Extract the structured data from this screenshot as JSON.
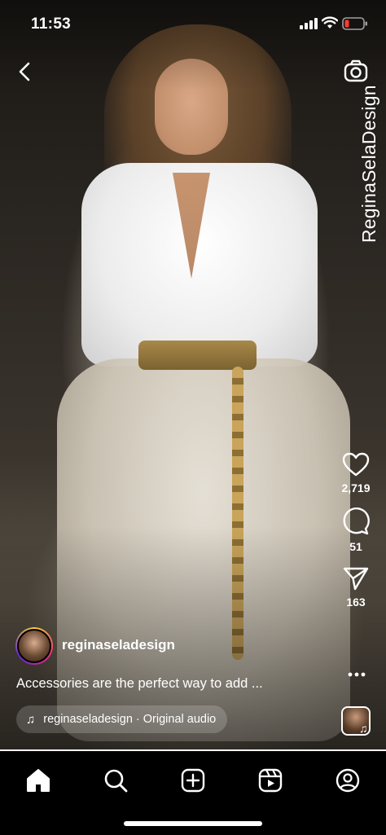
{
  "status_bar": {
    "time": "11:53"
  },
  "watermark": {
    "text": "ReginaSelaDesign"
  },
  "post": {
    "username": "reginaseladesign",
    "caption": "Accessories are the perfect way to add ...",
    "audio_label": "reginaseladesign · Original audio"
  },
  "actions": {
    "likes": "2,719",
    "comments": "51",
    "shares": "163"
  },
  "playback": {
    "progress": 1.0
  },
  "icons": {
    "back": "chevron-left-icon",
    "camera": "camera-icon",
    "like": "heart-icon",
    "comment": "comment-bubble-icon",
    "share": "paper-plane-icon",
    "more": "more-horizontal-icon",
    "nav": [
      "home-icon",
      "search-icon",
      "create-icon",
      "reels-icon",
      "profile-icon"
    ]
  },
  "colors": {
    "background": "#000000",
    "text": "#ffffff",
    "avatar_ring": [
      "#f9ce34",
      "#ee2a7b",
      "#6228d7"
    ]
  }
}
